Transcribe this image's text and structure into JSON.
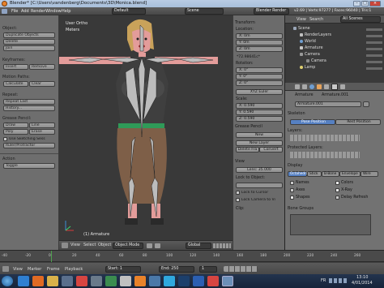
{
  "titlebar": {
    "text": "Blender* [C:\\Users\\vandenberg\\Documents\\3D\\Monica.blend]"
  },
  "infobar": {
    "menus": [
      "File",
      "Add",
      "Render",
      "Window",
      "Help"
    ],
    "layout": "Default",
    "scene": "Scene",
    "engine": "Blender Render",
    "stats": "v2.69 | Verts:97277 | Faces:96040 | Tris:1"
  },
  "toolshelf": {
    "object_header": "Object:",
    "duplicate": "Duplicate Objects",
    "delete": "Delete",
    "join": "Join",
    "keyframes_header": "Keyframes:",
    "insert": "Insert",
    "remove": "Remove",
    "motion_header": "Motion Paths:",
    "calculate": "Calculate",
    "clear": "Clear",
    "repeat_header": "Repeat:",
    "repeat_last": "Repeat Last",
    "history": "History...",
    "grease_header": "Grease Pencil:",
    "draw": "Draw",
    "line": "Line",
    "poly": "Poly",
    "erase": "Erase",
    "sketching": "Use Sketching Sess",
    "ruler": "Ruler/Protractor",
    "action_header": "Action",
    "toggle": "Toggle"
  },
  "viewport": {
    "view_label": "User Ortho",
    "units": "Meters",
    "object_label": "(1) Armature",
    "mode": "Object Mode",
    "header_menus": [
      "View",
      "Select",
      "Object"
    ],
    "pivot": "Global"
  },
  "transform": {
    "header": "Transform",
    "location_label": "Location:",
    "location": [
      "X: 0m",
      "Y: 0m",
      "Z: 0m"
    ],
    "rotation_label": "Rotation:",
    "rotation": [
      "X: 0°",
      "Y: 0°",
      "Z: 0°"
    ],
    "z_value": "*72.98641c*",
    "euler": "XYZ Euler",
    "scale_label": "Scale:",
    "scale": [
      "X: 0.590",
      "Y: 0.590",
      "Z: 0.590"
    ]
  },
  "grease": {
    "header": "Grease Pencil",
    "new": "New",
    "new_layer": "New Layer",
    "delete_frame": "Delete Fra",
    "convert": "Convert"
  },
  "view": {
    "header": "View",
    "lens": "Lens: 35.000",
    "lock_object": "Lock to Object:",
    "lock_cursor": "Lock to Cursor",
    "lock_camera": "Lock Camera to Vi",
    "clip": "Clip:"
  },
  "outliner": {
    "view": "View",
    "search": "Search",
    "scope": "All Scenes",
    "items": [
      "Scene",
      "RenderLayers",
      "World",
      "Armature",
      "Camera",
      "Camera",
      "Lamp"
    ]
  },
  "rprops": {
    "breadcrumb": [
      "Armature",
      "Armature.001"
    ],
    "name_field": "Armature.001",
    "skeleton_header": "Skeleton",
    "pose_position": "Pose Position",
    "rest_position": "Rest Position",
    "layers": "Layers:",
    "protected": "Protected Layers:",
    "display_header": "Display",
    "display_types": [
      "Octahedral",
      "Stick",
      "B-Bone",
      "Envelope",
      "Wire"
    ],
    "checks": [
      "Names",
      "Axes",
      "Shapes",
      "Colors",
      "X-Ray",
      "Delay Refresh"
    ],
    "bone_groups": "Bone Groups"
  },
  "timeline": {
    "menus": [
      "View",
      "Marker",
      "Frame",
      "Playback"
    ],
    "start": "Start: 1",
    "end": "End: 250",
    "current": "1",
    "ticks": [
      "-40",
      "-20",
      "0",
      "20",
      "40",
      "60",
      "80",
      "100",
      "120",
      "140",
      "160",
      "180",
      "200",
      "220",
      "240",
      "260"
    ]
  },
  "taskbar": {
    "lang": "FR",
    "time": "13:10",
    "date": "4/01/2014"
  }
}
